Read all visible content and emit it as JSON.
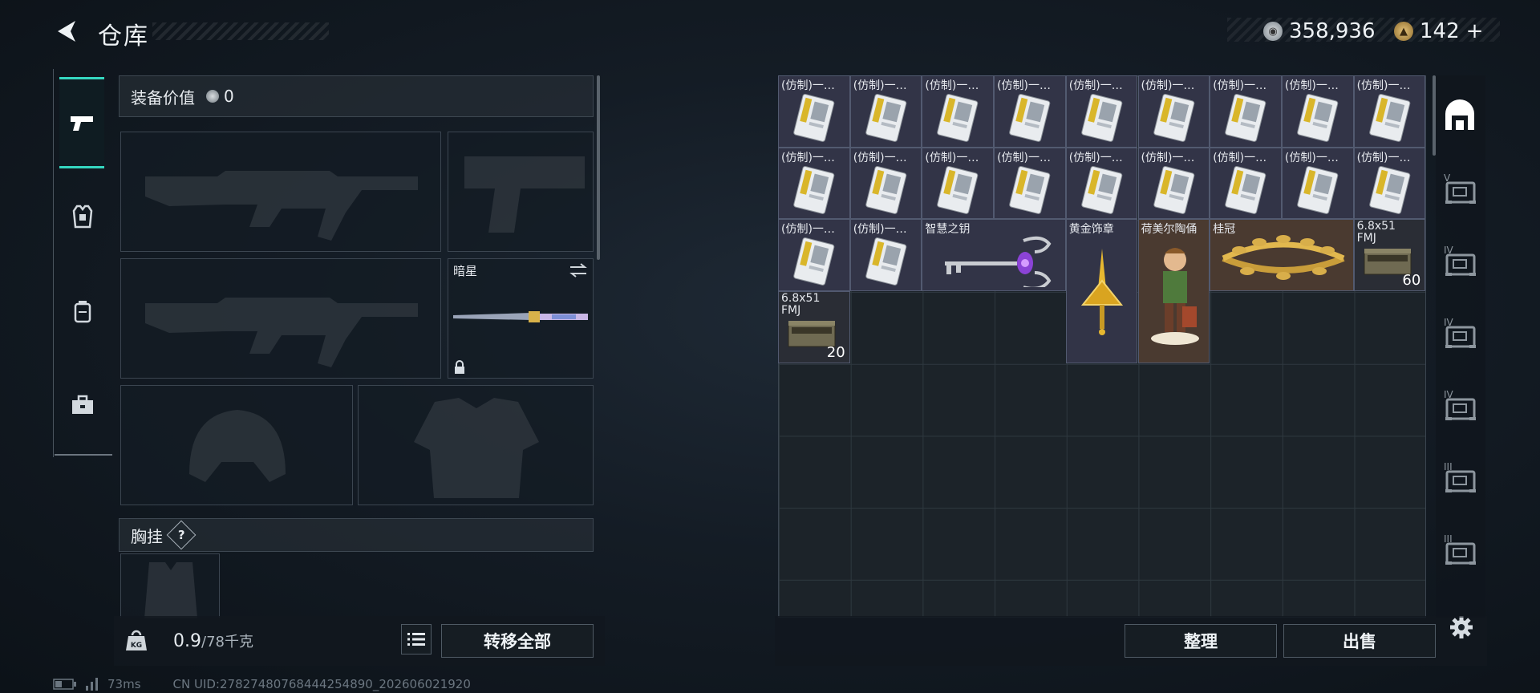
{
  "header": {
    "title": "仓库",
    "silver": "358,936",
    "gold": "142",
    "plus": "+"
  },
  "equip": {
    "value_label": "装备价值",
    "value": "0",
    "knife_name": "暗星",
    "chest_label": "胸挂",
    "help": "?"
  },
  "bottom": {
    "weight": "0.9",
    "weight_max": "/78千克",
    "transfer_all": "转移全部",
    "sort": "整理",
    "sell": "出售"
  },
  "footer": {
    "ping": "73ms",
    "uid": "CN UID:27827480768444254890_202606021920"
  },
  "grid": {
    "cells": [
      {
        "label": "(仿制)一…"
      },
      {
        "label": "(仿制)一…"
      },
      {
        "label": "(仿制)一…"
      },
      {
        "label": "(仿制)一…"
      },
      {
        "label": "(仿制)一…"
      },
      {
        "label": "(仿制)一…"
      },
      {
        "label": "(仿制)一…"
      },
      {
        "label": "(仿制)一…"
      },
      {
        "label": "(仿制)一…"
      },
      {
        "label": "(仿制)一…"
      },
      {
        "label": "(仿制)一…"
      },
      {
        "label": "(仿制)一…"
      },
      {
        "label": "(仿制)一…"
      },
      {
        "label": "(仿制)一…"
      },
      {
        "label": "(仿制)一…"
      },
      {
        "label": "(仿制)一…"
      },
      {
        "label": "(仿制)一…"
      },
      {
        "label": "(仿制)一…"
      },
      {
        "label": "(仿制)一…"
      },
      {
        "label": "(仿制)一…"
      }
    ],
    "key": {
      "label": "智慧之钥"
    },
    "badge": {
      "label": "黄金饰章"
    },
    "figurine": {
      "label": "荷美尔陶俑"
    },
    "crown": {
      "label": "桂冠"
    },
    "ammo1": {
      "label": "6.8x51",
      "sub": "FMJ",
      "qty": "60"
    },
    "ammo2": {
      "label": "6.8x51",
      "sub": "FMJ",
      "qty": "20"
    }
  },
  "side_tabs": [
    "V",
    "IV",
    "IV",
    "IV",
    "III",
    "III"
  ],
  "colors": {
    "accent": "#35d7c0",
    "cell_bg": "#323447",
    "cell_gold": "#4a3a30"
  }
}
